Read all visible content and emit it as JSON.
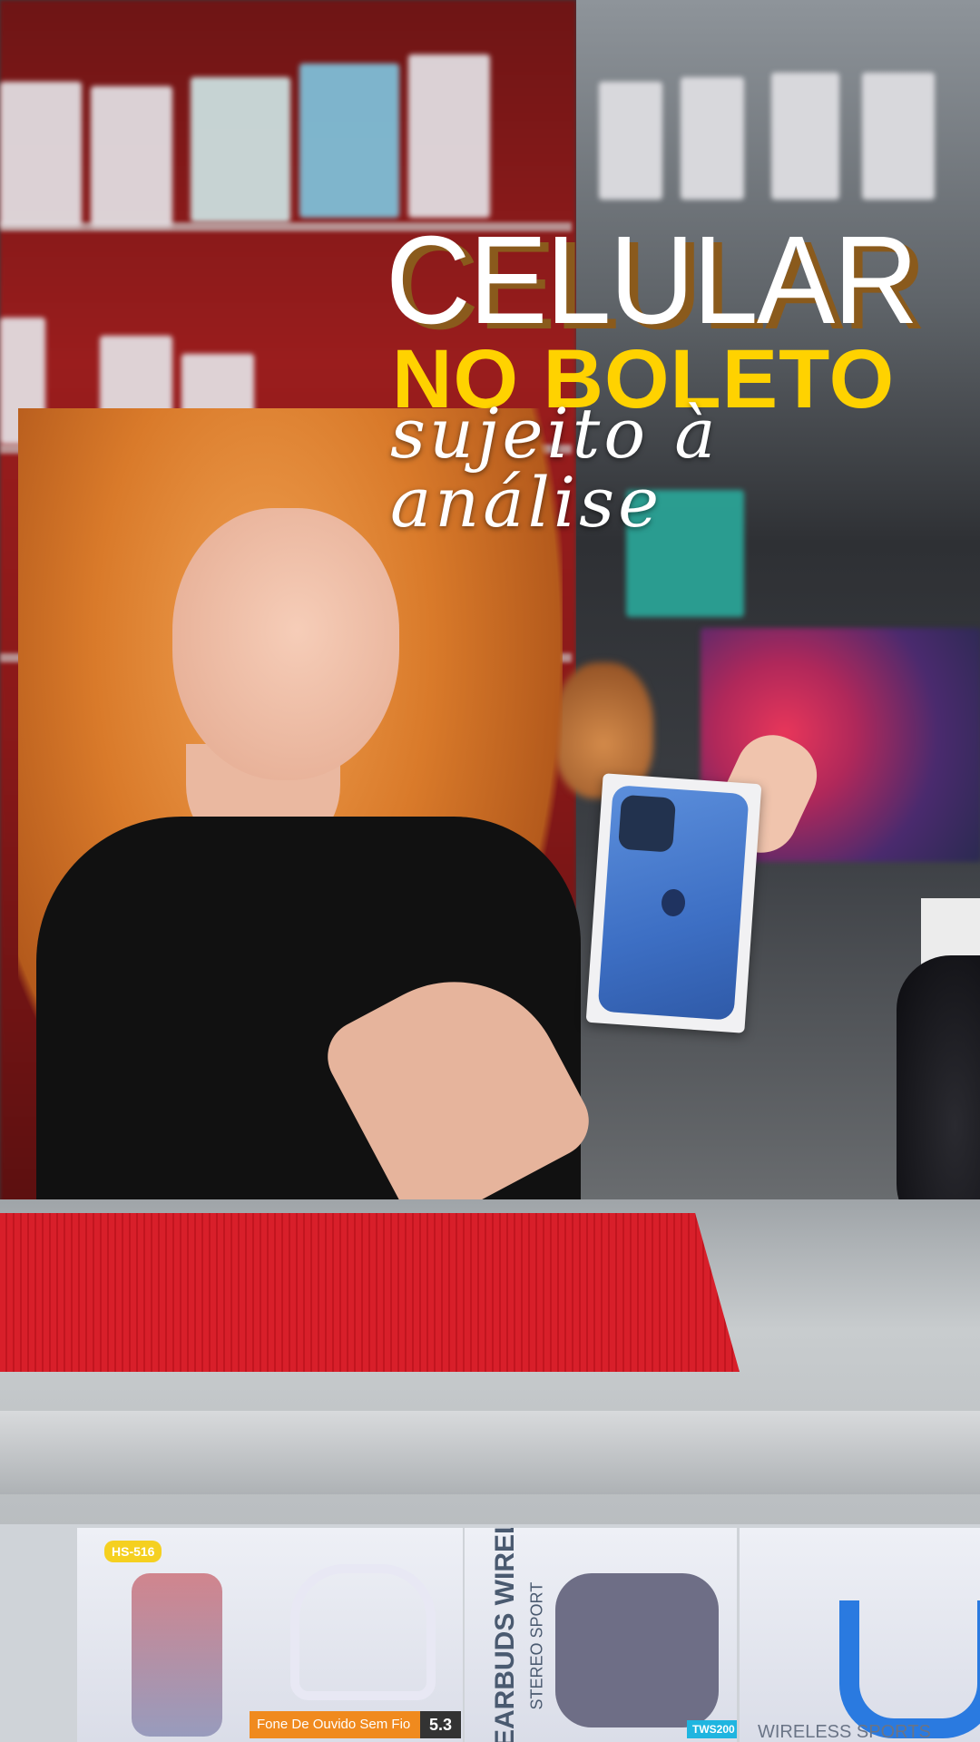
{
  "headline": {
    "line1": "CELULAR",
    "line2": "NO BOLETO",
    "line3": "sujeito à análise"
  },
  "colors": {
    "headline_white": "#ffffff",
    "headline_yellow": "#ffd200",
    "headline_shadow": "#8a5a1c",
    "counter_mat_red": "#d81f2a"
  },
  "products": {
    "box1_model": "HS-516",
    "box2_label": "Fone De Ouvido Sem Fio",
    "box2_version": "5.3",
    "box3_title": "EARBUDS WIRELESS",
    "box3_subtitle": "STEREO SPORT",
    "box3_model": "TWS200",
    "box4_title": "WIRELESS SPORTS"
  }
}
